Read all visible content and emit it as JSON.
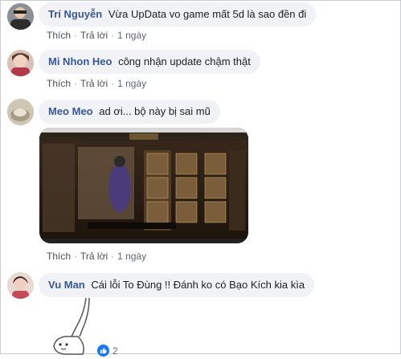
{
  "comments": [
    {
      "name": "Trí Nguyễn",
      "text": "Vừa UpData vo game mất 5d là sao đền đi",
      "like": "Thích",
      "reply": "Trả lời",
      "time": "1 ngày"
    },
    {
      "name": "Mi Nhon Heo",
      "text": "công nhận update chậm thật",
      "like": "Thích",
      "reply": "Trả lời",
      "time": "1 ngày"
    },
    {
      "name": "Meo Meo",
      "text": "ad ơi... bộ này bị sai mũ",
      "like": "Thích",
      "reply": "Trả lời",
      "time": "1 ngày"
    },
    {
      "name": "Vu Man",
      "text": "Cái lỗi To Đùng !! Đánh ko có Bạo Kích kia kìa"
    }
  ],
  "reaction": {
    "count": "2",
    "icon": "like-icon",
    "color": "#1877f2"
  },
  "colors": {
    "name": "#385898",
    "bubble": "#f0f2f5",
    "meta": "#606770"
  }
}
